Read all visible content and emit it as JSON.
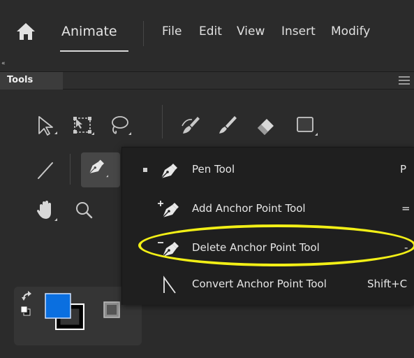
{
  "menubar": {
    "app_name": "Animate",
    "items": [
      {
        "label": "File"
      },
      {
        "label": "Edit"
      },
      {
        "label": "View"
      },
      {
        "label": "Insert"
      },
      {
        "label": "Modify"
      }
    ]
  },
  "tools_panel": {
    "tab_label": "Tools",
    "collapse_glyph": "«",
    "rows": [
      [
        "selection-icon",
        "free-transform-icon",
        "lasso-icon",
        "paint-brush-icon",
        "brush-icon",
        "eraser-icon",
        "rectangle-icon"
      ],
      [
        "line-icon",
        "pen-icon"
      ],
      [
        "hand-icon",
        "zoom-icon"
      ]
    ],
    "colors": {
      "stroke": "#000000",
      "fill": "#0a6fe0"
    }
  },
  "flyout": {
    "items": [
      {
        "label": "Pen Tool",
        "shortcut": "P",
        "selected": true,
        "icon": "pen-icon"
      },
      {
        "label": "Add Anchor Point Tool",
        "shortcut": "=",
        "selected": false,
        "icon": "add-anchor-point-icon"
      },
      {
        "label": "Delete Anchor Point Tool",
        "shortcut": "-",
        "selected": false,
        "icon": "delete-anchor-point-icon"
      },
      {
        "label": "Convert Anchor Point Tool",
        "shortcut": "Shift+C",
        "selected": false,
        "icon": "convert-anchor-point-icon"
      }
    ],
    "highlight_color": "#f2ef16"
  }
}
